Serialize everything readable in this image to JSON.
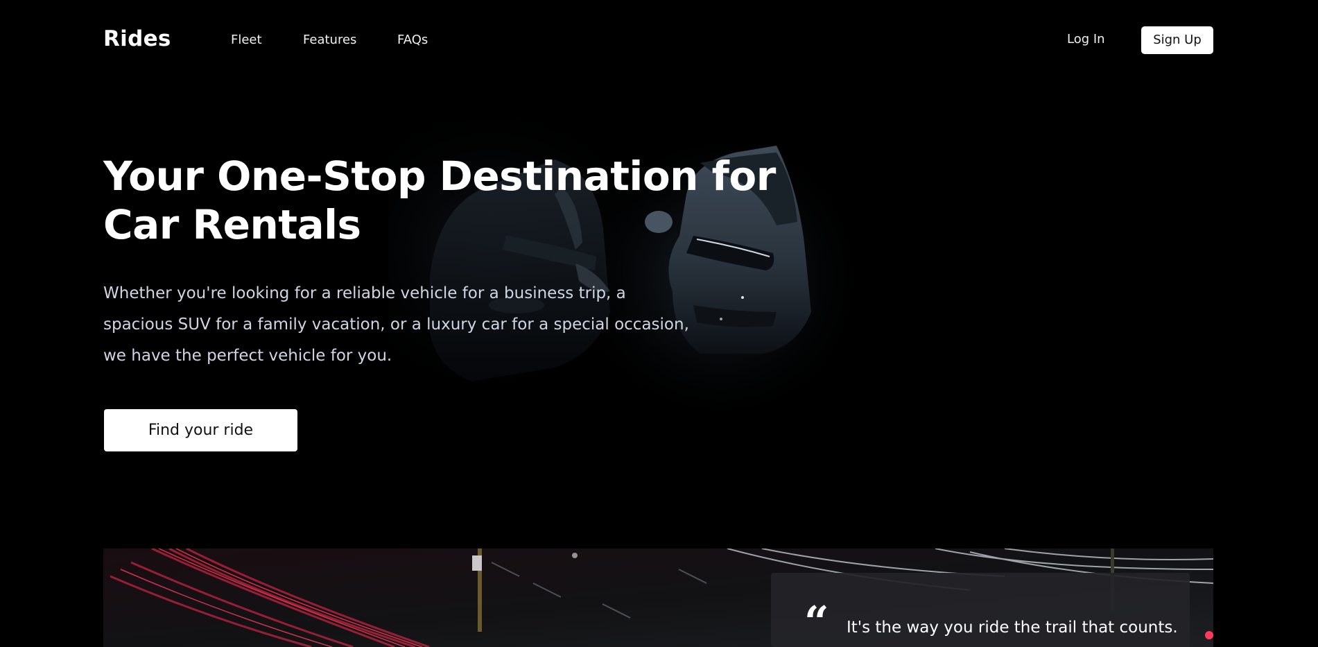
{
  "nav": {
    "logo": "Rides",
    "links": [
      {
        "label": "Fleet"
      },
      {
        "label": "Features"
      },
      {
        "label": "FAQs"
      }
    ],
    "login_label": "Log In",
    "signup_label": "Sign Up"
  },
  "hero": {
    "title": "Your One-Stop Destination for Car Rentals",
    "description": "Whether you're looking for a reliable vehicle for a business trip, a spacious SUV for a family vacation, or a luxury car for a special occasion, we have the perfect vehicle for you.",
    "cta_label": "Find your ride"
  },
  "testimonial": {
    "quote_mark": "“",
    "text": "It's the way you ride the trail that counts."
  },
  "colors": {
    "background": "#000000",
    "button_bg": "#ffffff",
    "button_text": "#111111",
    "body_text": "#cfd6e4",
    "quote_card": "#242428"
  }
}
